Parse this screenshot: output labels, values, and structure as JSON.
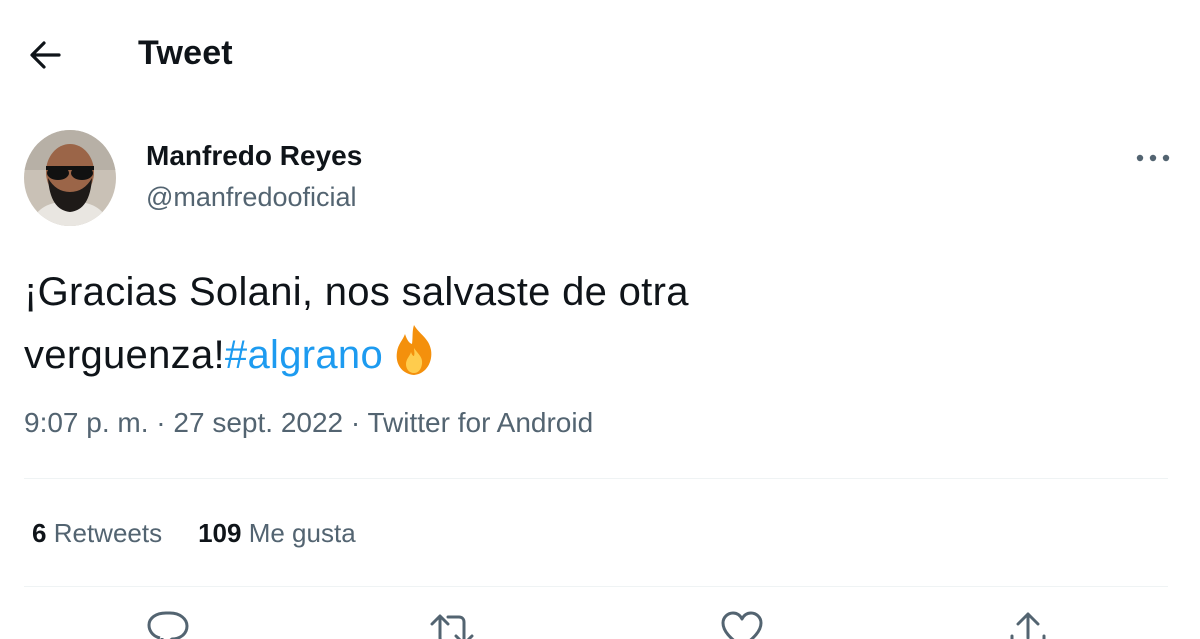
{
  "header": {
    "back_icon": "arrow-left-icon",
    "title": "Tweet"
  },
  "author": {
    "name": "Manfredo Reyes",
    "handle": "@manfredooficial",
    "avatar_icon": "avatar"
  },
  "tweet": {
    "text_line1": "¡Gracias Solani, nos salvaste de otra",
    "text_line2": "verguenza!",
    "hashtag": "#algrano",
    "emoji_icon": "fire-emoji-icon",
    "time": "9:07 p. m.",
    "separator": " · ",
    "date": "27 sept. 2022",
    "source": "Twitter for Android"
  },
  "stats": {
    "retweets_count": "6",
    "retweets_label": "Retweets",
    "likes_count": "109",
    "likes_label": "Me gusta"
  },
  "actions": [
    "reply-icon",
    "retweet-icon",
    "like-icon",
    "share-icon"
  ],
  "colors": {
    "link": "#1d9bf0",
    "secondary_text": "#536471",
    "divider": "#eff3f4"
  }
}
